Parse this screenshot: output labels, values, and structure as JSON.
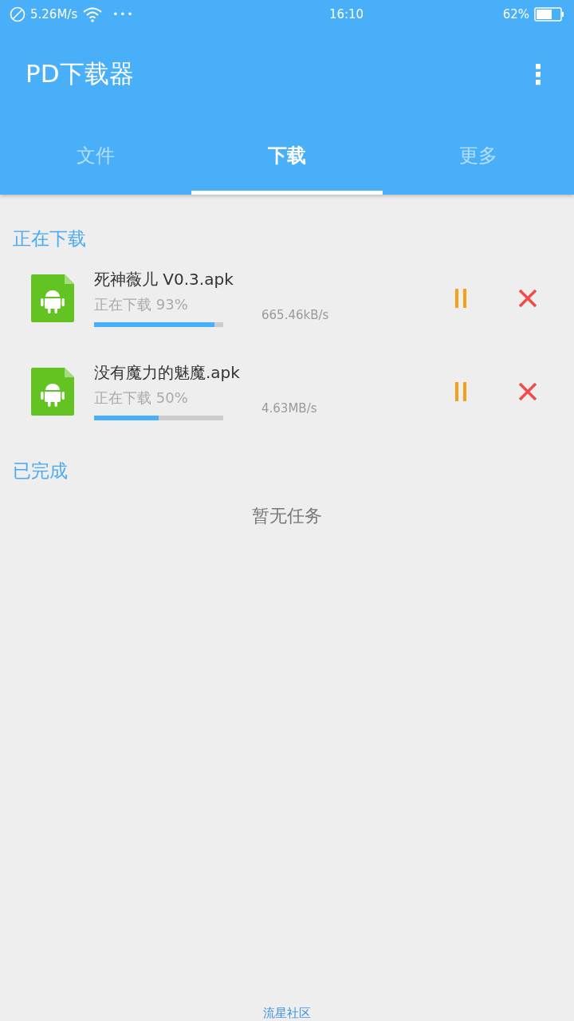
{
  "status_bar": {
    "speed": "5.26M/s",
    "dots": "•••",
    "time": "16:10",
    "battery": "62%"
  },
  "app_bar": {
    "title": "PD下载器",
    "menu": "⋮"
  },
  "tabs": [
    {
      "label": "文件",
      "selected": false
    },
    {
      "label": "下载",
      "selected": true
    },
    {
      "label": "更多",
      "selected": false
    }
  ],
  "downloading": {
    "heading": "正在下载",
    "items": [
      {
        "name": "死神薇儿 V0.3.apk",
        "status": "正在下载 93%",
        "level": 0.93,
        "speed": "665.46kB/s"
      },
      {
        "name": "没有魔力的魅魔.apk",
        "status": "正在下载 50%",
        "level": 0.5,
        "speed": "4.63MB/s"
      }
    ]
  },
  "completed": {
    "heading": "已完成",
    "empty": "暂无任务"
  },
  "footer": "流星社区"
}
